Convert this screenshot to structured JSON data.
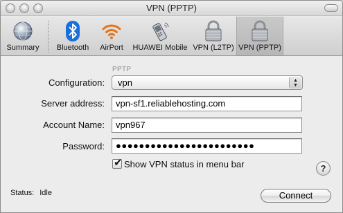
{
  "window": {
    "title": "VPN (PPTP)"
  },
  "toolbar": {
    "items": [
      {
        "label": "Summary",
        "icon": "globe-icon"
      },
      {
        "label": "Bluetooth",
        "icon": "bluetooth-icon"
      },
      {
        "label": "AirPort",
        "icon": "airport-icon"
      },
      {
        "label": "HUAWEI Mobile",
        "icon": "phone-icon"
      },
      {
        "label": "VPN (L2TP)",
        "icon": "lock-icon"
      },
      {
        "label": "VPN (PPTP)",
        "icon": "lock-icon",
        "selected": true
      }
    ]
  },
  "form": {
    "section_label": "PPTP",
    "configuration": {
      "label": "Configuration:",
      "value": "vpn"
    },
    "server_address": {
      "label": "Server address:",
      "value": "vpn-sf1.reliablehosting.com"
    },
    "account_name": {
      "label": "Account Name:",
      "value": "vpn967"
    },
    "password": {
      "label": "Password:",
      "value": "●●●●●●●●●●●●●●●●●●●●●●●●"
    },
    "show_status": {
      "label": "Show VPN status in menu bar",
      "checked": true
    }
  },
  "help": {
    "label": "?"
  },
  "status": {
    "label": "Status:",
    "value": "Idle"
  },
  "connect": {
    "label": "Connect"
  },
  "colors": {
    "bluetooth": "#1b6fd8",
    "airport": "#e5731a",
    "window_bg": "#ececec"
  }
}
